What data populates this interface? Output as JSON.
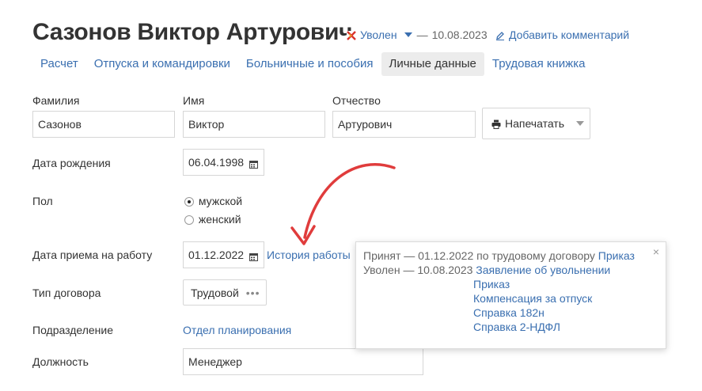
{
  "header": {
    "name": "Сазонов Виктор Артурович",
    "status_label": "Уволен",
    "status_separator": "—",
    "status_date": "10.08.2023",
    "add_comment": "Добавить комментарий",
    "status_icon": "fired-icon",
    "comment_icon": "pencil-icon"
  },
  "tabs": [
    {
      "label": "Расчет"
    },
    {
      "label": "Отпуска и командировки"
    },
    {
      "label": "Больничные и пособия"
    },
    {
      "label": "Личные данные"
    },
    {
      "label": "Трудовая книжка"
    }
  ],
  "form": {
    "surname_label": "Фамилия",
    "surname_value": "Сазонов",
    "name_label": "Имя",
    "name_value": "Виктор",
    "patronymic_label": "Отчество",
    "patronymic_value": "Артурович",
    "print_label": "Напечатать",
    "birth_label": "Дата рождения",
    "birth_value": "06.04.1998",
    "gender_label": "Пол",
    "gender_male": "мужской",
    "gender_female": "женский",
    "gender_selected": "мужской",
    "hire_label": "Дата приема на работу",
    "hire_value": "01.12.2022",
    "history_link": "История работы",
    "contract_label": "Тип договора",
    "contract_value": "Трудовой",
    "dept_label": "Подразделение",
    "dept_value": "Отдел планирования",
    "position_label": "Должность",
    "position_value": "Менеджер"
  },
  "popup": {
    "hired_text": "Принят — 01.12.2022 по трудовому договору",
    "hired_link": "Приказ",
    "fired_text": "Уволен — 10.08.2023",
    "fired_links": [
      "Заявление об увольнении",
      "Приказ",
      "Компенсация за отпуск",
      "Справка 182н",
      "Справка 2-НДФЛ"
    ],
    "close": "×"
  },
  "colors": {
    "link": "#3a6fb0",
    "arrow": "#e03c3c",
    "status_icon": "#d9322c"
  }
}
